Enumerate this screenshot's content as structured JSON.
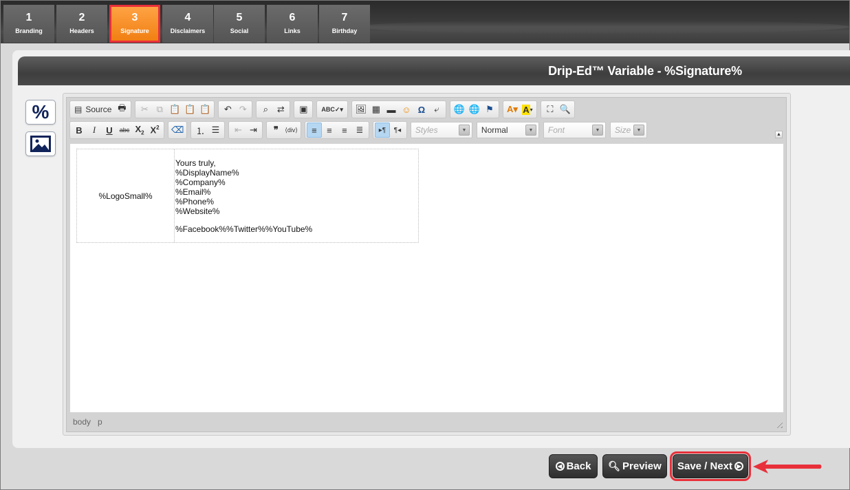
{
  "steps": [
    {
      "num": "1",
      "label": "Branding"
    },
    {
      "num": "2",
      "label": "Headers"
    },
    {
      "num": "3",
      "label": "Signature"
    },
    {
      "num": "4",
      "label": "Disclaimers"
    },
    {
      "num": "5",
      "label": "Social"
    },
    {
      "num": "6",
      "label": "Links"
    },
    {
      "num": "7",
      "label": "Birthday"
    }
  ],
  "active_step": "3",
  "panel": {
    "title": "Drip-Ed™ Variable - %Signature%"
  },
  "side": {
    "percent_label": "%"
  },
  "toolbar": {
    "source_label": "Source",
    "styles_placeholder": "Styles",
    "format_value": "Normal",
    "font_placeholder": "Font",
    "size_placeholder": "Size"
  },
  "signature": {
    "logo": "%LogoSmall%",
    "lines": [
      "Yours truly,",
      "%DisplayName%",
      "%Company%",
      "%Email%",
      "%Phone%",
      "%Website%"
    ],
    "social": "%Facebook%%Twitter%%YouTube%"
  },
  "statusbar": {
    "path": [
      "body",
      "p"
    ]
  },
  "buttons": {
    "back": "Back",
    "preview": "Preview",
    "save": "Save / Next"
  },
  "colors": {
    "active_tab": "#f5891f",
    "highlight": "#e8303a",
    "dark": "#3a3a3a"
  }
}
